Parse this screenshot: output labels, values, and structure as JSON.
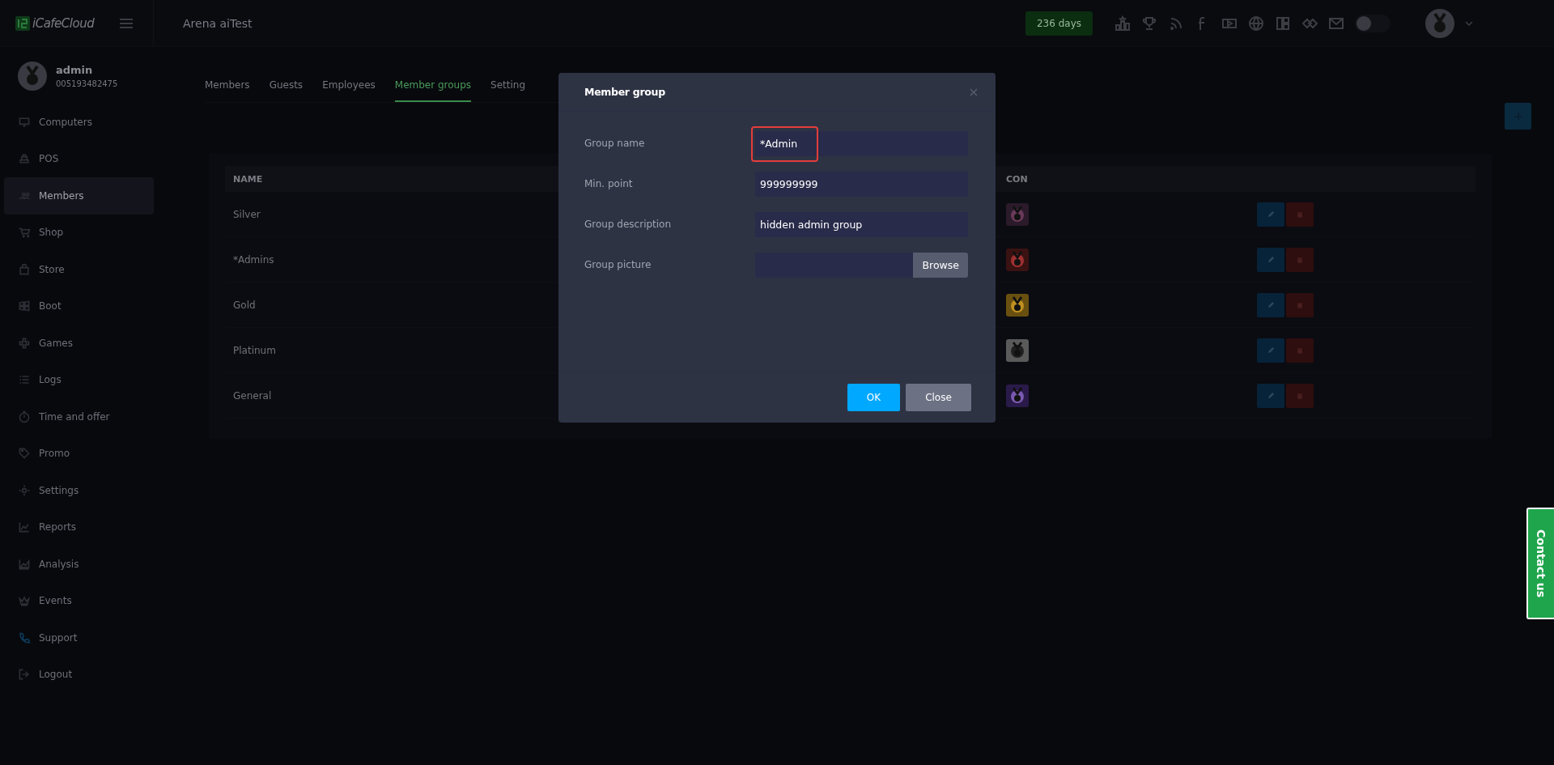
{
  "header": {
    "logo": "iCafeCloud",
    "title": "Arena aiTest",
    "days_badge": "236 days",
    "theme_toggle_on": false
  },
  "user": {
    "name": "admin",
    "id": "005193482475"
  },
  "sidebar": {
    "items": [
      {
        "label": "Computers",
        "selected": false
      },
      {
        "label": "POS",
        "selected": false
      },
      {
        "label": "Members",
        "selected": true
      },
      {
        "label": "Shop",
        "selected": false
      },
      {
        "label": "Store",
        "selected": false
      },
      {
        "label": "Boot",
        "selected": false
      },
      {
        "label": "Games",
        "selected": false
      },
      {
        "label": "Logs",
        "selected": false
      },
      {
        "label": "Time and offer",
        "selected": false
      },
      {
        "label": "Promo",
        "selected": false
      },
      {
        "label": "Settings",
        "selected": false
      },
      {
        "label": "Reports",
        "selected": false
      },
      {
        "label": "Analysis",
        "selected": false
      },
      {
        "label": "Events",
        "selected": false
      },
      {
        "label": "Support",
        "selected": false
      },
      {
        "label": "Logout",
        "selected": false
      }
    ]
  },
  "tabs": [
    {
      "label": "Members",
      "selected": false
    },
    {
      "label": "Guests",
      "selected": false
    },
    {
      "label": "Employees",
      "selected": false
    },
    {
      "label": "Member groups",
      "selected": true
    },
    {
      "label": "Setting",
      "selected": false
    }
  ],
  "table": {
    "columns": [
      "NAME",
      "CON"
    ],
    "rows": [
      {
        "name": "Silver"
      },
      {
        "name": "*Admins"
      },
      {
        "name": "Gold"
      },
      {
        "name": "Platinum"
      },
      {
        "name": "General"
      }
    ]
  },
  "modal": {
    "title": "Member group",
    "fields": [
      {
        "kind": "text",
        "label": "Group name",
        "value": "*Admin",
        "highlighted": true
      },
      {
        "kind": "text",
        "label": "Min. point",
        "value": "999999999",
        "highlighted": false
      },
      {
        "kind": "text",
        "label": "Group description",
        "value": "hidden admin group",
        "highlighted": false
      },
      {
        "kind": "file",
        "label": "Group picture",
        "button": "Browse",
        "highlighted": false
      }
    ],
    "buttons": [
      {
        "label": "OK",
        "kind": "primary"
      },
      {
        "label": "Close",
        "kind": "secondary"
      }
    ]
  },
  "contact_button": "Contact us"
}
